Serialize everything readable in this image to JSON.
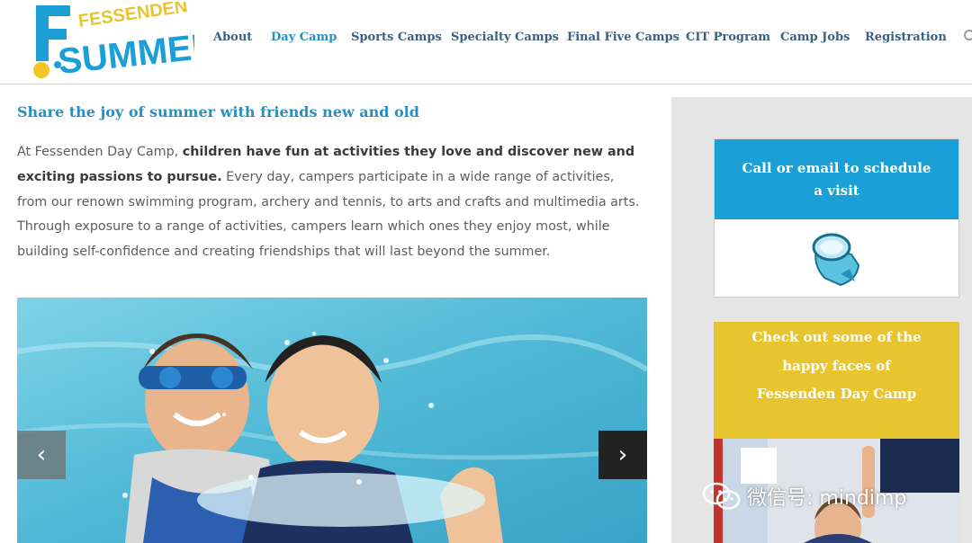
{
  "brand": {
    "logo_top": "FESSENDEN",
    "logo_bottom": "SUMMER",
    "logo_initial": "F"
  },
  "nav": {
    "items": [
      {
        "label": "About"
      },
      {
        "label": "Day Camp"
      },
      {
        "label": "Sports Camps"
      },
      {
        "label": "Specialty Camps"
      },
      {
        "label": "Final Five Camps"
      },
      {
        "label": "CIT Program"
      },
      {
        "label": "Camp Jobs"
      },
      {
        "label": "Registration"
      }
    ],
    "active": "Day Camp"
  },
  "main": {
    "headline": "Share the joy of summer with friends new and old",
    "intro_lead": "At Fessenden Day Camp, ",
    "intro_bold": "children have fun at activities they love and discover new and exciting passions to pursue.",
    "intro_rest": " Every day, campers participate in a wide range of activities, from our renown swimming program, archery and tennis, to arts and crafts and multimedia arts. Through exposure to a range of activities, campers learn which ones they enjoy most, while building self-confidence and creating friendships that will last beyond the summer."
  },
  "slider": {
    "prev_label": "‹",
    "next_label": "›"
  },
  "sidebar": {
    "visit_title": "Call or email to schedule a visit",
    "faces_title_1": "Check out some of the",
    "faces_title_2": "happy faces of",
    "faces_title_3": "Fessenden Day Camp"
  },
  "watermark": {
    "text": "微信号: mindimp"
  },
  "colors": {
    "accent_blue": "#1a9fd6",
    "link_blue": "#2a8fc0",
    "nav_text": "#3b5f7e",
    "yellow": "#e8c42e",
    "sidebar_bg": "#e5e5e5"
  }
}
